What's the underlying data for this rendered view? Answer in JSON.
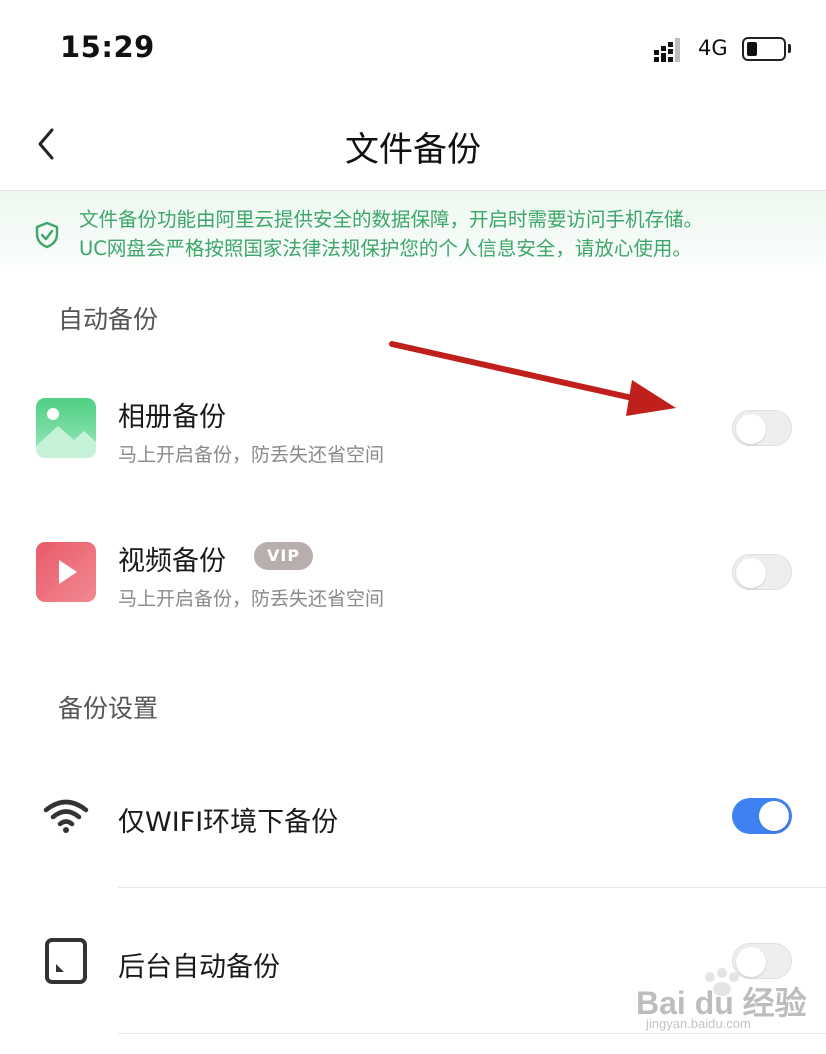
{
  "status_bar": {
    "time": "15:29",
    "network": "4G"
  },
  "nav": {
    "title": "文件备份"
  },
  "notice": {
    "line1": "文件备份功能由阿里云提供安全的数据保障，开启时需要访问手机存储。",
    "line2": "UC网盘会严格按照国家法律法规保护您的个人信息安全，请放心使用。"
  },
  "auto_backup": {
    "title": "自动备份",
    "items": [
      {
        "title": "相册备份",
        "subtitle": "马上开启备份，防丢失还省空间",
        "enabled": false
      },
      {
        "title": "视频备份",
        "badge": "VIP",
        "subtitle": "马上开启备份，防丢失还省空间",
        "enabled": false
      }
    ]
  },
  "settings": {
    "title": "备份设置",
    "items": [
      {
        "title": "仅WIFI环境下备份",
        "enabled": true
      },
      {
        "title": "后台自动备份",
        "enabled": false
      }
    ]
  },
  "watermark": {
    "brand": "Bai du 经验",
    "url": "jingyan.baidu.com"
  },
  "colors": {
    "accent": "#3e82f1",
    "notice_text": "#3da66a",
    "arrow": "#c0201b",
    "photo_icon": "#5fd38f",
    "video_icon": "#ee6b78"
  }
}
